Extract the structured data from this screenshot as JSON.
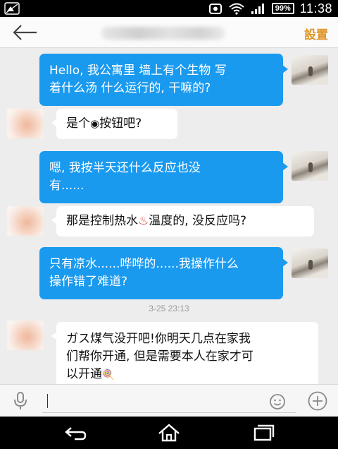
{
  "status_bar": {
    "battery": "99%",
    "time": "11:38",
    "icons": [
      "signal-off-icon",
      "alarm-icon",
      "wifi-icon",
      "signal-bars-icon",
      "battery-icon"
    ]
  },
  "header": {
    "settings_label": "設置",
    "back_icon": "arrow-left-icon"
  },
  "messages": [
    {
      "side": "out",
      "lines": [
        "Hello, 我公寓里 墙上有个生物 写",
        "着什么汤 什么运行的, 干嘛的?"
      ]
    },
    {
      "side": "in",
      "lines": [
        "是个",
        "按钮吧?"
      ],
      "glyph": "◉"
    },
    {
      "side": "out",
      "lines": [
        "嗯, 我按半天还什么反应也没",
        "有......"
      ]
    },
    {
      "side": "in",
      "lines": [
        "那是控制热水",
        "温度的, 没反应吗?"
      ],
      "glyph": "♨"
    },
    {
      "side": "out",
      "lines": [
        "只有凉水......哗哗的......我操作什么",
        "操作错了难道?"
      ]
    },
    {
      "side": "in",
      "lines": [
        "ガス煤气没开吧!你明天几点在家我",
        "们帮你开通, 但是需要本人在家才可",
        "以开通"
      ],
      "glyph": "🍭"
    }
  ],
  "timestamp": "3-25 23:13",
  "composer": {
    "placeholder": "",
    "mic_icon": "microphone-icon",
    "emoji_icon": "emoji-icon",
    "plus_icon": "plus-icon"
  },
  "navigation": {
    "icons": [
      "back-nav-icon",
      "home-nav-icon",
      "recent-apps-icon"
    ]
  },
  "colors": {
    "outgoing_bubble": "#1a9aef",
    "settings_text": "#e0962a",
    "chat_background": "#ededed"
  }
}
